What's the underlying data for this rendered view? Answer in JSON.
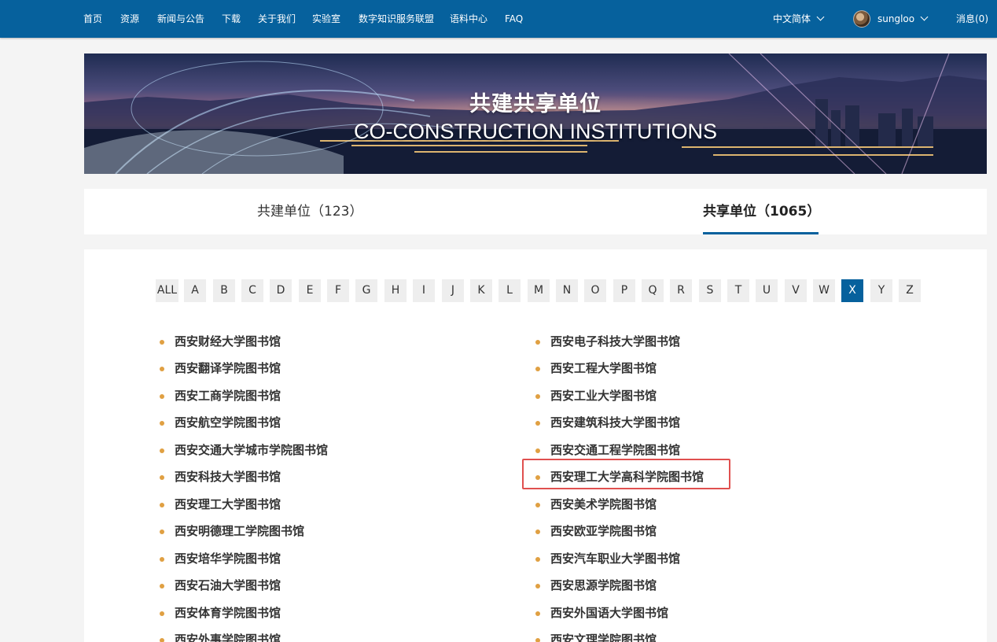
{
  "nav": {
    "items": [
      "首页",
      "资源",
      "新闻与公告",
      "下载",
      "关于我们",
      "实验室",
      "数字知识服务联盟",
      "语料中心",
      "FAQ"
    ],
    "language": "中文简体",
    "username": "sungloo",
    "messages": "消息(0)"
  },
  "banner": {
    "title_zh": "共建共享单位",
    "title_en": "CO-CONSTRUCTION INSTITUTIONS"
  },
  "tabs": [
    {
      "label": "共建单位（123）",
      "active": false
    },
    {
      "label": "共享单位（1065）",
      "active": true
    }
  ],
  "letters": [
    "ALL",
    "A",
    "B",
    "C",
    "D",
    "E",
    "F",
    "G",
    "H",
    "I",
    "J",
    "K",
    "L",
    "M",
    "N",
    "O",
    "P",
    "Q",
    "R",
    "S",
    "T",
    "U",
    "V",
    "W",
    "X",
    "Y",
    "Z"
  ],
  "active_letter": "X",
  "institutions": {
    "left": [
      "西安财经大学图书馆",
      "西安翻译学院图书馆",
      "西安工商学院图书馆",
      "西安航空学院图书馆",
      "西安交通大学城市学院图书馆",
      "西安科技大学图书馆",
      "西安理工大学图书馆",
      "西安明德理工学院图书馆",
      "西安培华学院图书馆",
      "西安石油大学图书馆",
      "西安体育学院图书馆",
      "西安外事学院图书馆"
    ],
    "right": [
      "西安电子科技大学图书馆",
      "西安工程大学图书馆",
      "西安工业大学图书馆",
      "西安建筑科技大学图书馆",
      "西安交通工程学院图书馆",
      "西安理工大学高科学院图书馆",
      "西安美术学院图书馆",
      "西安欧亚学院图书馆",
      "西安汽车职业大学图书馆",
      "西安思源学院图书馆",
      "西安外国语大学图书馆",
      "西安文理学院图书馆"
    ]
  },
  "highlighted": "西安理工大学高科学院图书馆",
  "colors": {
    "nav_bg": "#06619d",
    "accent": "#06619d",
    "bullet": "#e0a042",
    "highlight_border": "#e0504f"
  }
}
